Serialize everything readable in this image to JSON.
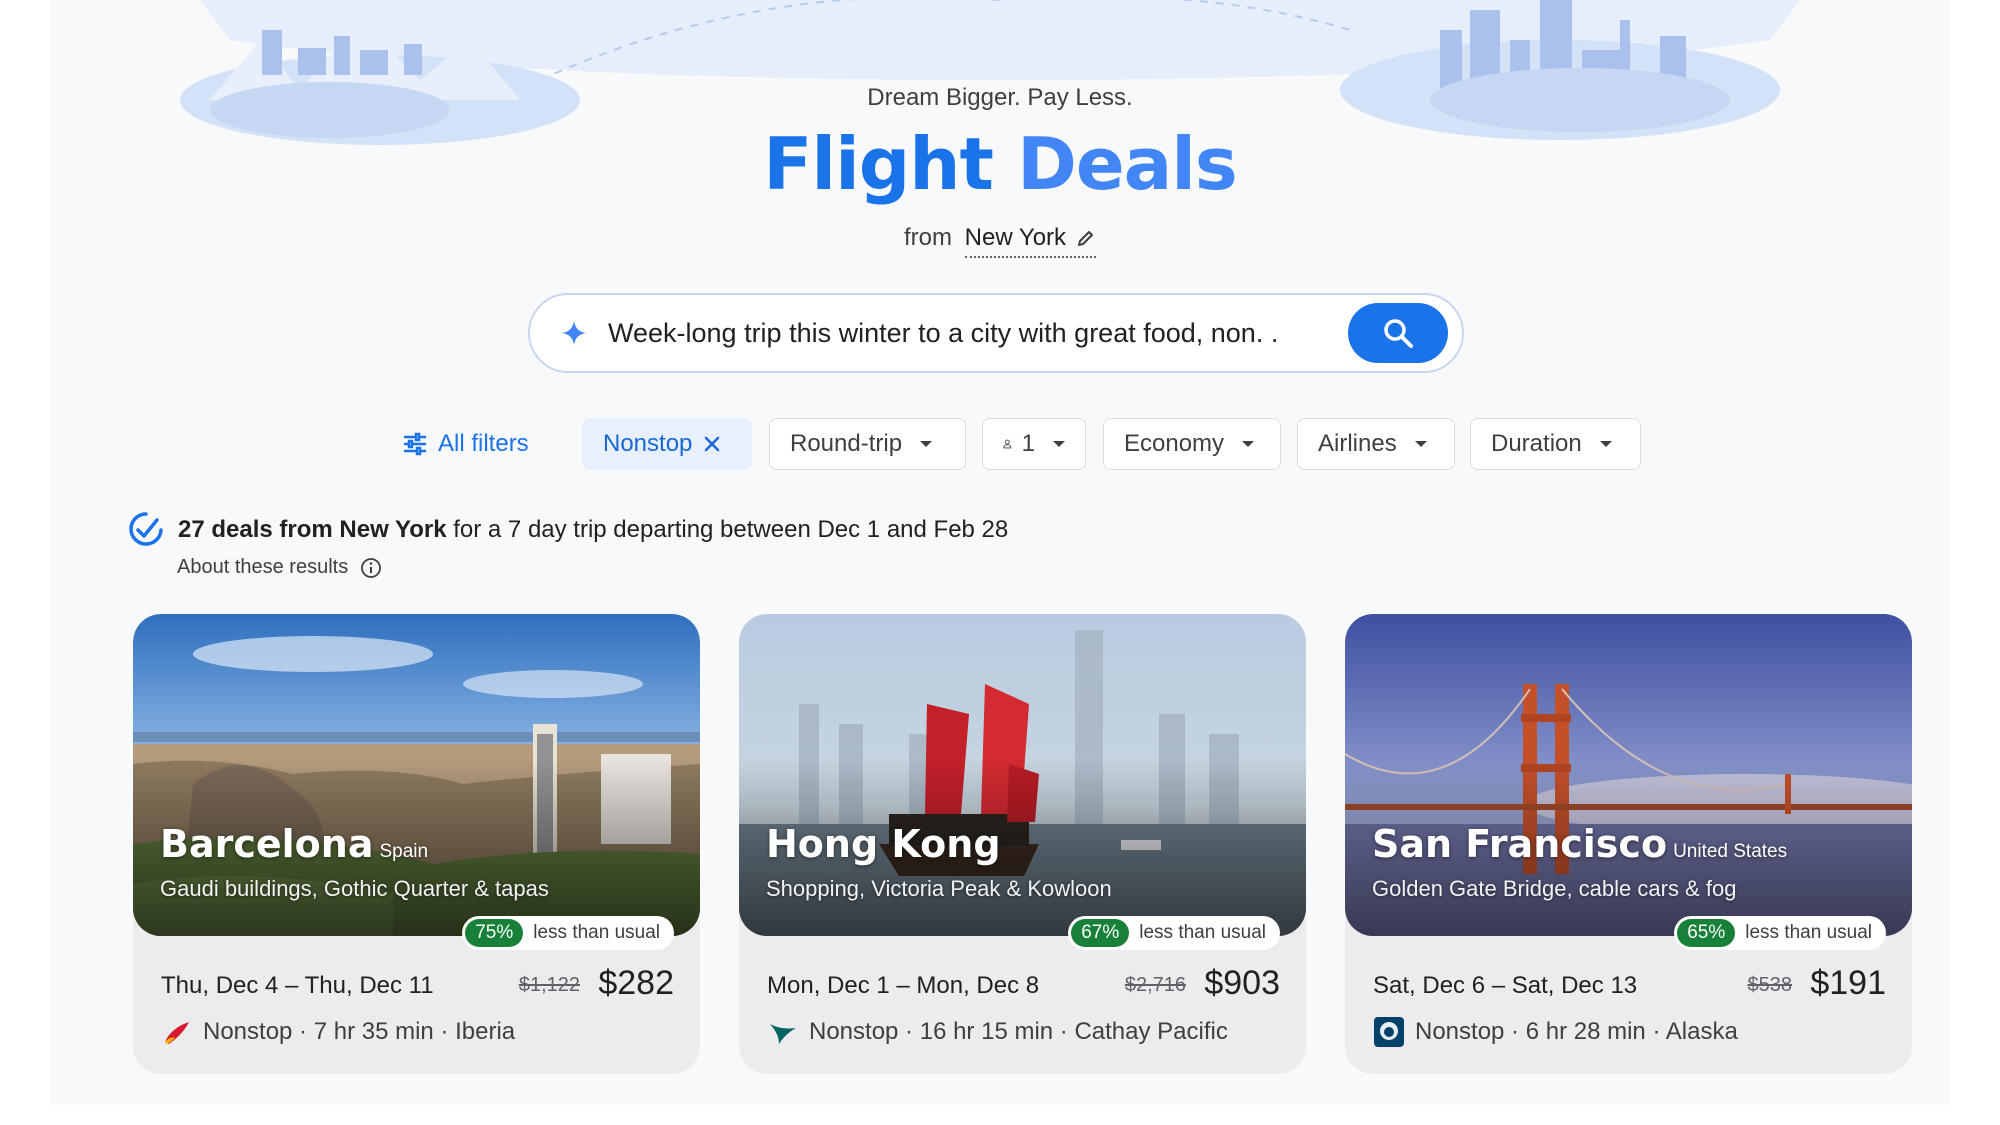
{
  "header": {
    "tagline": "Dream Bigger. Pay Less.",
    "title_word1": "Flight",
    "title_word2": "Deals",
    "origin_prefix": "from",
    "origin_city": "New York"
  },
  "search": {
    "query": "Week-long trip this winter to a city with great food, non. ."
  },
  "filters": {
    "all_filters": "All filters",
    "nonstop": "Nonstop",
    "trip_type": "Round-trip",
    "passengers": "1",
    "cabin": "Economy",
    "airlines": "Airlines",
    "duration": "Duration"
  },
  "summary": {
    "count_text": "27 deals from New York",
    "rest_text": " for a 7 day trip departing between Dec 1 and Feb 28",
    "about": "About these results"
  },
  "deals": [
    {
      "city": "Barcelona",
      "country": "Spain",
      "tagline": "Gaudi buildings, Gothic Quarter & tapas",
      "discount": "75%",
      "discount_label": "less than usual",
      "dates": "Thu, Dec 4 – Thu, Dec 11",
      "usual_price": "$1,122",
      "price": "$282",
      "flight": "Nonstop · 7 hr 35 min · Iberia",
      "airline_logo": "iberia-logo"
    },
    {
      "city": "Hong Kong",
      "country": "",
      "tagline": "Shopping, Victoria Peak & Kowloon",
      "discount": "67%",
      "discount_label": "less than usual",
      "dates": "Mon, Dec 1 – Mon, Dec 8",
      "usual_price": "$2,716",
      "price": "$903",
      "flight": "Nonstop · 16 hr 15 min · Cathay Pacific",
      "airline_logo": "cathay-pacific-logo"
    },
    {
      "city": "San Francisco",
      "country": "United States",
      "tagline": "Golden Gate Bridge, cable cars & fog",
      "discount": "65%",
      "discount_label": "less than usual",
      "dates": "Sat, Dec 6 – Sat, Dec 13",
      "usual_price": "$538",
      "price": "$191",
      "flight": "Nonstop · 6 hr 28 min · Alaska",
      "airline_logo": "alaska-logo"
    }
  ],
  "colors": {
    "accent": "#1a73e8",
    "discount_green": "#188038",
    "chip_selected": "#e8f0fe"
  }
}
